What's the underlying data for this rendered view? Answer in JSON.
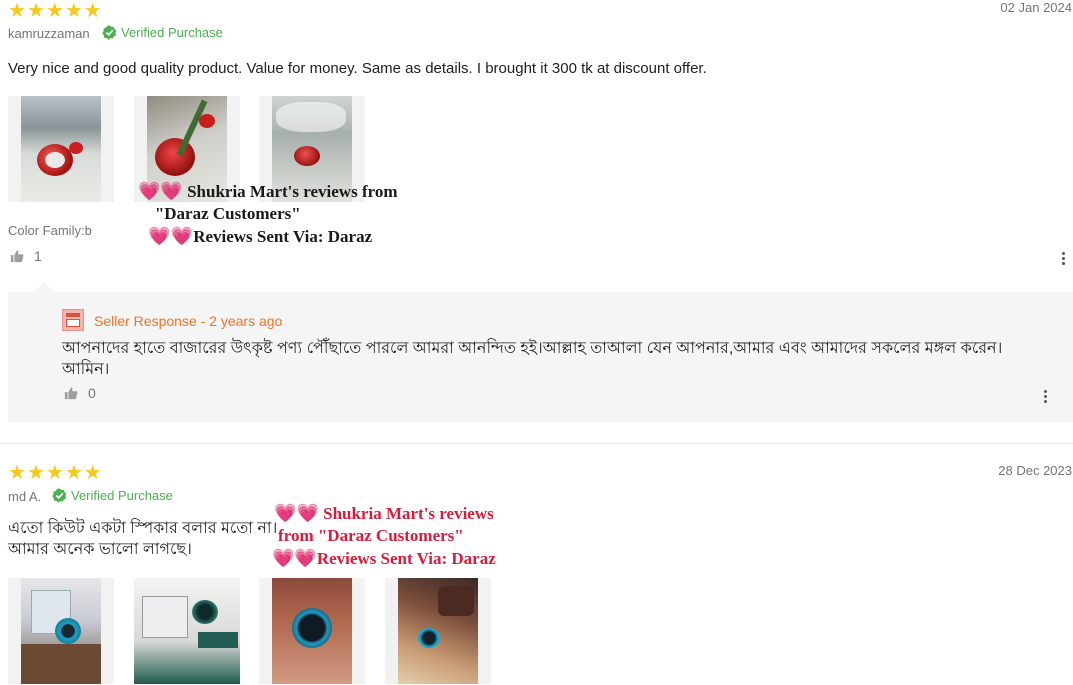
{
  "reviews": [
    {
      "rating": 5,
      "reviewer": "kamruzzaman",
      "verified": "Verified Purchase",
      "date": "02 Jan 2024",
      "content": "Very nice and good quality product. Value for money. Same as details. I brought it 300 tk at discount offer.",
      "sku": "Color Family:b",
      "likes": "1",
      "seller_response": {
        "title": "Seller Response - 2 years ago",
        "text": "আপনাদের হাতে বাজারের উৎকৃষ্ট পণ্য পৌঁছাতে পারলে আমরা আনন্দিত হই।আল্লাহ তাআলা যেন আপনার,আমার এবং আমাদের সকলের মঙ্গল করেন। আমিন।",
        "likes": "0"
      }
    },
    {
      "rating": 5,
      "reviewer": "md A.",
      "verified": "Verified Purchase",
      "date": "28 Dec 2023",
      "content_line1": "এতো কিউট একটা স্পিকার বলার মতো না।",
      "content_line2": "আমার অনেক ভালো লাগছে।"
    }
  ],
  "watermark": {
    "line1": "Shukria Mart's reviews from",
    "line2": "\"Daraz Customers\"",
    "line3": "Reviews Sent Via: Daraz",
    "line1_b": "Shukria Mart's reviews",
    "line2_b": "from \"Daraz Customers\"",
    "line3_b": "Reviews Sent Via: Daraz",
    "hearts": "💗💗"
  },
  "colors": {
    "star": "#f8c91c",
    "verified": "#4caf50",
    "seller_accent": "#f57224",
    "watermark_red": "#d91c3c"
  },
  "icons": [
    "star-icon",
    "verified-check-icon",
    "thumbs-up-icon",
    "kebab-menu-icon",
    "store-icon"
  ]
}
